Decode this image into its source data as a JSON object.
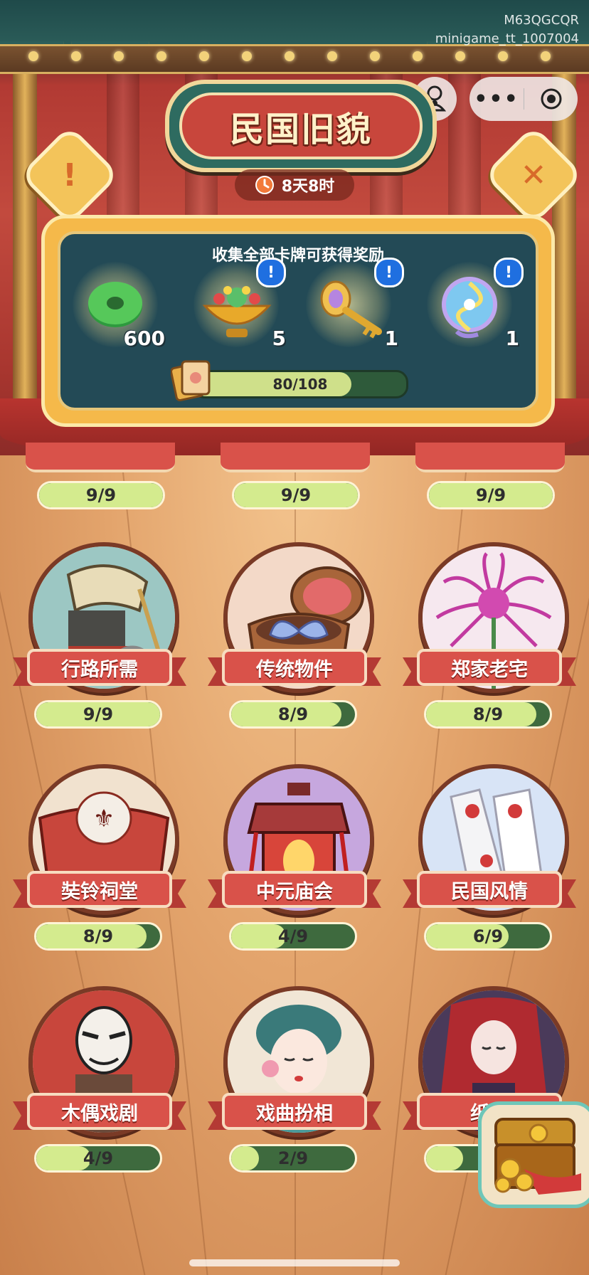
{
  "system": {
    "watermark_line1": "M63QGCQR",
    "watermark_line2": "minigame_tt_1007004"
  },
  "header": {
    "title": "民国旧貌",
    "timer": "8天8时",
    "info_button_icon": "exclamation-icon",
    "close_button_icon": "close-icon"
  },
  "rewards": {
    "heading": "收集全部卡牌可获得奖励",
    "items": [
      {
        "icon": "jade-coin-icon",
        "count": "600"
      },
      {
        "icon": "treasure-bowl-icon",
        "count": "5"
      },
      {
        "icon": "golden-key-icon",
        "count": "1"
      },
      {
        "icon": "magic-orb-icon",
        "count": "1"
      }
    ],
    "progress_text": "80/108",
    "progress_fraction": 0.741
  },
  "hidden_row": [
    {
      "progress": "9/9",
      "fraction": 1.0
    },
    {
      "progress": "9/9",
      "fraction": 1.0
    },
    {
      "progress": "9/9",
      "fraction": 1.0
    }
  ],
  "categories": [
    {
      "name": "行路所需",
      "progress": "9/9",
      "fraction": 1.0,
      "icon": "rickshaw-icon"
    },
    {
      "name": "传统物件",
      "progress": "8/9",
      "fraction": 0.889,
      "icon": "butterfly-box-icon"
    },
    {
      "name": "郑家老宅",
      "progress": "8/9",
      "fraction": 0.889,
      "icon": "spider-lily-icon"
    },
    {
      "name": "奘铃祠堂",
      "progress": "8/9",
      "fraction": 0.889,
      "icon": "altar-icon"
    },
    {
      "name": "中元庙会",
      "progress": "4/9",
      "fraction": 0.444,
      "icon": "lantern-icon"
    },
    {
      "name": "民国风情",
      "progress": "6/9",
      "fraction": 0.667,
      "icon": "lace-gloves-icon"
    },
    {
      "name": "木偶戏剧",
      "progress": "4/9",
      "fraction": 0.444,
      "icon": "puppet-icon"
    },
    {
      "name": "戏曲扮相",
      "progress": "2/9",
      "fraction": 0.222,
      "icon": "opera-girl-icon"
    },
    {
      "name": "纸嫁",
      "progress": "",
      "fraction": 0.3,
      "icon": "paper-bride-icon"
    }
  ],
  "colors": {
    "bar_fill": "#d4eb8e",
    "bar_track": "#3e6a3e",
    "banner": "#d9524a",
    "panel": "#234a56"
  }
}
